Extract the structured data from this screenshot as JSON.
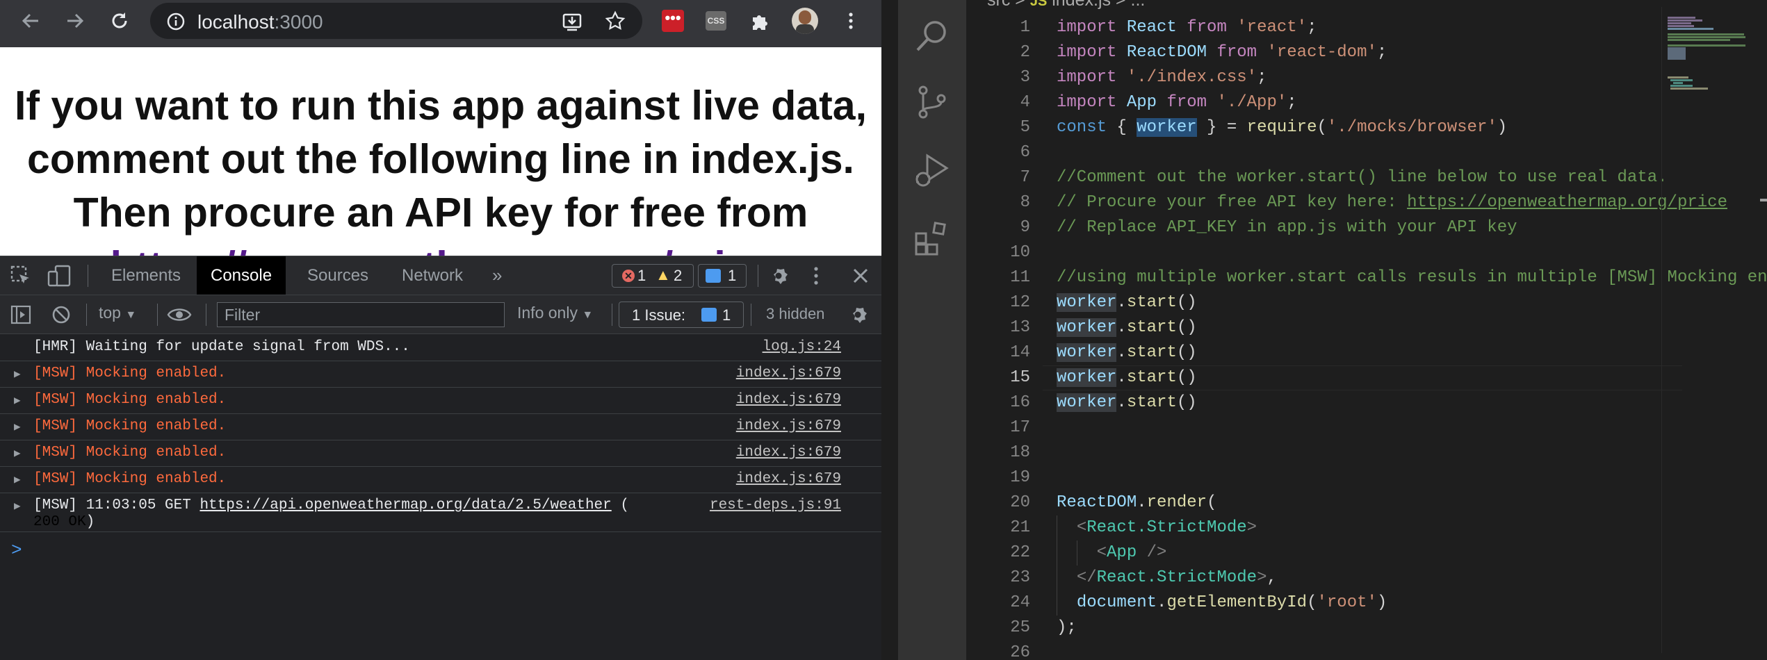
{
  "browser": {
    "url_host": "localhost",
    "url_port": ":3000",
    "page": {
      "heading_text": "If you want to run this app against live data, comment out the following line in index.js. Then procure an API key for free from ",
      "heading_link": "https://openweathermap.org/price"
    }
  },
  "devtools": {
    "tabs": [
      "Elements",
      "Console",
      "Sources",
      "Network"
    ],
    "active_tab": "Console",
    "badges": {
      "errors": "1",
      "warnings": "2",
      "messages": "1"
    },
    "context": "top",
    "filter_placeholder": "Filter",
    "levels": "Info only",
    "issues_label": "1 Issue:",
    "issues_count": "1",
    "hidden": "3 hidden",
    "console": [
      {
        "type": "plain",
        "text": "[HMR] Waiting for update signal from WDS...",
        "source": "log.js:24"
      },
      {
        "type": "err",
        "text": "[MSW] Mocking enabled.",
        "source": "index.js:679"
      },
      {
        "type": "err",
        "text": "[MSW] Mocking enabled.",
        "source": "index.js:679"
      },
      {
        "type": "err",
        "text": "[MSW] Mocking enabled.",
        "source": "index.js:679"
      },
      {
        "type": "err",
        "text": "[MSW] Mocking enabled.",
        "source": "index.js:679"
      },
      {
        "type": "err",
        "text": "[MSW] Mocking enabled.",
        "source": "index.js:679"
      }
    ],
    "net_row": {
      "prefix": "[MSW] 11:03:05 GET ",
      "url": "https://api.openweathermap.org/data/2.5/weather",
      "paren": " (",
      "status": "200 OK",
      "close": ")",
      "source": "rest-deps.js:91"
    },
    "prompt": ">"
  },
  "editor": {
    "breadcrumb_folder": "src",
    "breadcrumb_icon": "JS",
    "breadcrumb_file": "index.js",
    "breadcrumb_more": "...",
    "current_line": 15,
    "line_numbers": [
      "1",
      "2",
      "3",
      "4",
      "5",
      "6",
      "7",
      "8",
      "9",
      "10",
      "11",
      "12",
      "13",
      "14",
      "15",
      "16",
      "17",
      "18",
      "19",
      "20",
      "21",
      "22",
      "23",
      "24",
      "25",
      "26"
    ],
    "code": {
      "l1": [
        "import",
        " React ",
        "from",
        " 'react'",
        ";"
      ],
      "l2": [
        "import",
        " ReactDOM ",
        "from",
        " 'react-dom'",
        ";"
      ],
      "l3": [
        "import",
        " './index.css'",
        ";"
      ],
      "l4": [
        "import",
        " App ",
        "from",
        " './App'",
        ";"
      ],
      "l5": [
        "const",
        " { ",
        "worker",
        " } = ",
        "require",
        "(",
        "'./mocks/browser'",
        ")"
      ],
      "l7": "//Comment out the worker.start() line below to use real data.",
      "l8_pre": "// Procure your free API key here: ",
      "l8_url": "https://openweathermap.org/price",
      "l9": "// Replace API_KEY in app.js with your API key",
      "l11": "//using multiple worker.start calls resuls in multiple [MSW] Mocking enabled logs",
      "worker": "worker",
      "start": "start",
      "call_tail": "()",
      "l20_obj": "ReactDOM",
      "l20_fn": "render",
      "l20_tail": "(",
      "strict": "React.StrictMode",
      "app": "App",
      "doc": "document",
      "getel": "getElementById",
      "root": "'root'",
      "l25": ");"
    }
  }
}
